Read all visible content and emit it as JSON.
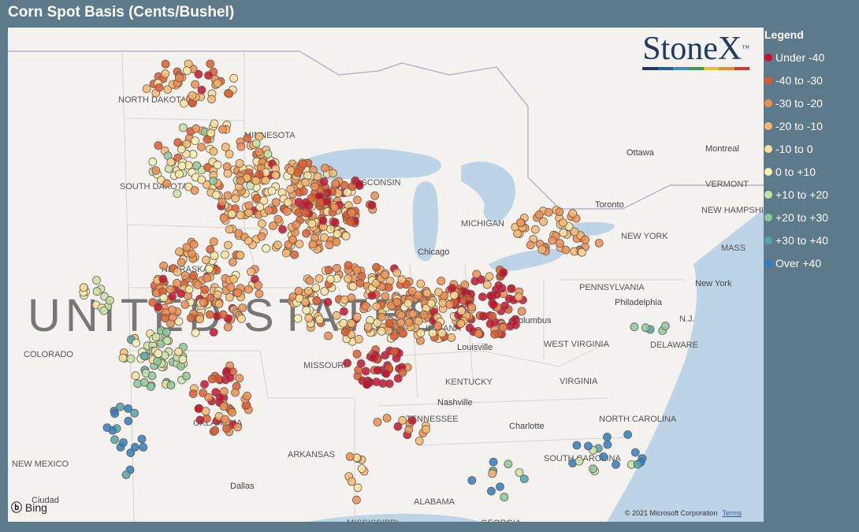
{
  "title": "Corn Spot Basis (Cents/Bushel)",
  "logo": "StoneX",
  "logo_mark": "™",
  "logo_bar_colors": [
    "#1f3a66",
    "#2a5aa8",
    "#3c8fc7",
    "#3a9a57",
    "#e3c32a",
    "#f08a24",
    "#d23a2a"
  ],
  "legend": {
    "title": "Legend",
    "items": [
      {
        "label": "Under -40",
        "color": "#c8102e"
      },
      {
        "label": "-40 to -30",
        "color": "#e05a2b"
      },
      {
        "label": "-30 to -20",
        "color": "#f08d4e"
      },
      {
        "label": "-20 to -10",
        "color": "#f7b96b"
      },
      {
        "label": "-10 to 0",
        "color": "#fbe29a"
      },
      {
        "label": "0 to +10",
        "color": "#f3f2b2"
      },
      {
        "label": "+10 to +20",
        "color": "#c5e4a3"
      },
      {
        "label": "+20 to +30",
        "color": "#8bc99a"
      },
      {
        "label": "+30 to +40",
        "color": "#4ea6a8"
      },
      {
        "label": "Over +40",
        "color": "#2d7ec1"
      }
    ]
  },
  "map_labels": [
    {
      "text": "NORTH DAKOTA",
      "size": "small"
    },
    {
      "text": "SOUTH DAKOTA",
      "size": "small"
    },
    {
      "text": "MINNESOTA",
      "size": "small"
    },
    {
      "text": "WISCONSIN",
      "size": "small"
    },
    {
      "text": "MICHIGAN",
      "size": "small"
    },
    {
      "text": "NEBRASKA",
      "size": "small"
    },
    {
      "text": "UNITED STATES",
      "size": "big"
    },
    {
      "text": "COLORADO",
      "size": "small"
    },
    {
      "text": "MISSOURI",
      "size": "small"
    },
    {
      "text": "KENTUCKY",
      "size": "small"
    },
    {
      "text": "TENNESSEE",
      "size": "small"
    },
    {
      "text": "OKLAHOMA",
      "size": "small"
    },
    {
      "text": "ARKANSAS",
      "size": "small"
    },
    {
      "text": "NEW MEXICO",
      "size": "small"
    },
    {
      "text": "ALABAMA",
      "size": "small"
    },
    {
      "text": "GEORGIA",
      "size": "small"
    },
    {
      "text": "MISSISSIPPI",
      "size": "small"
    },
    {
      "text": "INDIANA",
      "size": "small"
    },
    {
      "text": "WEST VIRGINIA",
      "size": "small"
    },
    {
      "text": "VIRGINIA",
      "size": "small"
    },
    {
      "text": "NORTH CAROLINA",
      "size": "small"
    },
    {
      "text": "SOUTH CAROLINA",
      "size": "small"
    },
    {
      "text": "PENNSYLVANIA",
      "size": "small"
    },
    {
      "text": "NEW YORK",
      "size": "small"
    },
    {
      "text": "VERMONT",
      "size": "small"
    },
    {
      "text": "NEW HAMPSHIRE",
      "size": "small"
    },
    {
      "text": "MASS",
      "size": "small"
    },
    {
      "text": "N.J.",
      "size": "small"
    },
    {
      "text": "DELAWARE",
      "size": "small"
    },
    {
      "text": "Chicago",
      "size": "city"
    },
    {
      "text": "Toronto",
      "size": "city"
    },
    {
      "text": "Ottawa",
      "size": "city"
    },
    {
      "text": "Montreal",
      "size": "city"
    },
    {
      "text": "New York",
      "size": "city"
    },
    {
      "text": "Philadelphia",
      "size": "city"
    },
    {
      "text": "Columbus",
      "size": "city"
    },
    {
      "text": "Louisville",
      "size": "city"
    },
    {
      "text": "Nashville",
      "size": "city"
    },
    {
      "text": "Charlotte",
      "size": "city"
    },
    {
      "text": "Dallas",
      "size": "city"
    },
    {
      "text": "Ciudad",
      "size": "city"
    }
  ],
  "attribution": {
    "bing": "Bing",
    "copyright": "© 2021 Microsoft Corporation",
    "terms": "Terms"
  }
}
